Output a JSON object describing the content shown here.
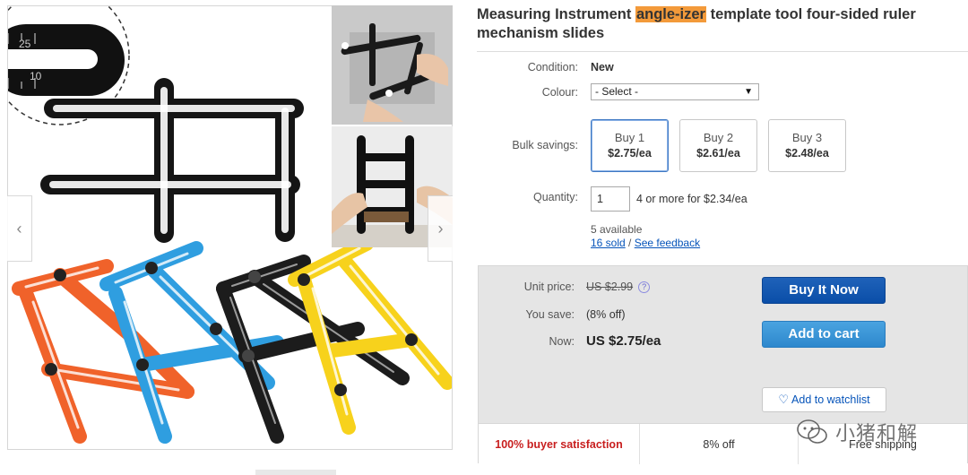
{
  "product": {
    "title_pre": "Measuring Instrument ",
    "title_highlight": "angle-izer",
    "title_post": " template tool four-sided ruler mechanism slides"
  },
  "zoom_ruler": {
    "mark_upper": "25",
    "mark_lower": "10"
  },
  "gallery": {
    "prev_icon": "chevron-left-icon",
    "next_icon": "chevron-right-icon"
  },
  "condition": {
    "label": "Condition:",
    "value": "New"
  },
  "colour": {
    "label": "Colour:",
    "selected": "- Select -"
  },
  "bulk": {
    "label": "Bulk savings:",
    "options": [
      {
        "top": "Buy 1",
        "bottom": "$2.75/ea",
        "selected": true
      },
      {
        "top": "Buy 2",
        "bottom": "$2.61/ea",
        "selected": false
      },
      {
        "top": "Buy 3",
        "bottom": "$2.48/ea",
        "selected": false
      }
    ]
  },
  "quantity": {
    "label": "Quantity:",
    "value": "1",
    "note": "4 or more for $2.34/ea",
    "available": "5 available",
    "sold_link": "16 sold",
    "separator": " / ",
    "feedback_link": "See feedback"
  },
  "pricing": {
    "unit_label": "Unit price:",
    "unit_value": "US $2.99",
    "save_label": "You save:",
    "save_value": "(8% off)",
    "now_label": "Now:",
    "now_value": "US $2.75/ea",
    "info_icon": "?"
  },
  "actions": {
    "buy_now": "Buy It Now",
    "add_to_cart": "Add to cart",
    "watchlist": "Add to watchlist"
  },
  "badges": [
    "100% buyer satisfaction",
    "8% off",
    "Free shipping"
  ],
  "watermark": {
    "text": "小猪和解"
  },
  "colors": {
    "highlight": "#f39a3a",
    "buy_now": "#0a4ea8",
    "add_to_cart": "#2d88cd",
    "link": "#0654ba",
    "satisfaction": "#c81e1e",
    "ruler_orange": "#f0622a",
    "ruler_blue": "#2f9ee0",
    "ruler_black": "#1c1c1c",
    "ruler_yellow": "#f7d21c"
  }
}
